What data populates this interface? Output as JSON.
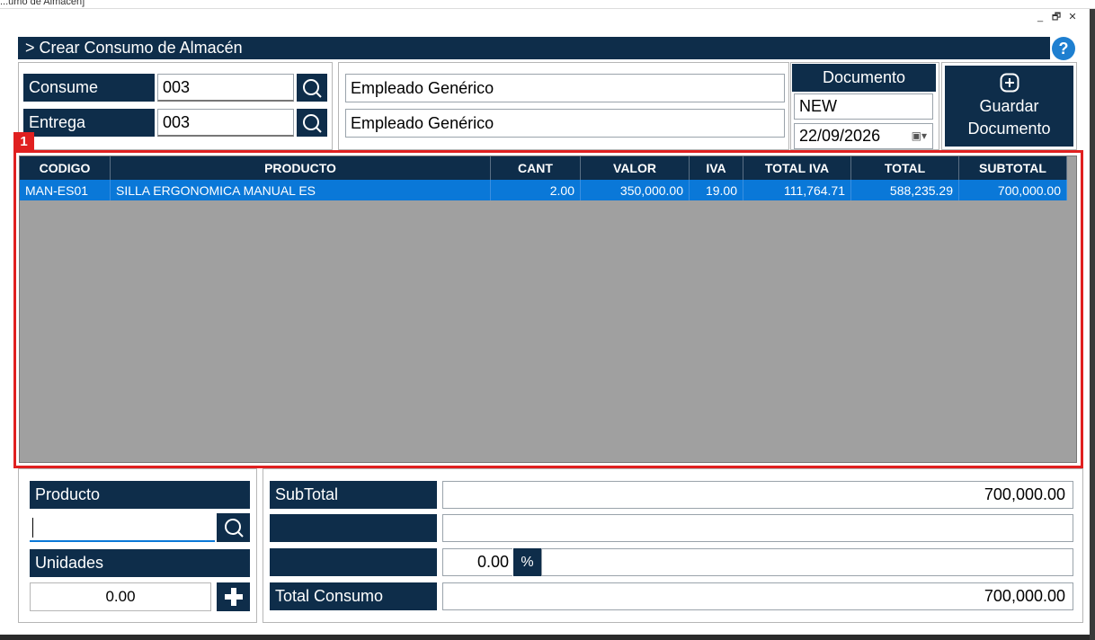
{
  "window": {
    "title": "...umo de Almacén]",
    "minimize": "_",
    "restore": "🗗",
    "close": "✕"
  },
  "header": {
    "title": "> Crear Consumo de Almacén",
    "help_icon": "?"
  },
  "form": {
    "consume_label": "Consume",
    "consume_value": "003",
    "entrega_label": "Entrega",
    "entrega_value": "003",
    "consume_name": "Empleado Genérico",
    "entrega_name": "Empleado Genérico",
    "documento_label": "Documento",
    "documento_value": "NEW",
    "fecha_value": "22/09/2026",
    "save_button_line1": "Guardar",
    "save_button_line2": "Documento"
  },
  "grid": {
    "marker": "1",
    "columns": [
      "CODIGO",
      "PRODUCTO",
      "CANT",
      "VALOR",
      "IVA",
      "TOTAL IVA",
      "TOTAL",
      "SUBTOTAL"
    ],
    "rows": [
      [
        "MAN-ES01",
        "SILLA ERGONOMICA MANUAL ES",
        "2.00",
        "350,000.00",
        "19.00",
        "111,764.71",
        "588,235.29",
        "700,000.00"
      ]
    ]
  },
  "bottom_left": {
    "producto_label": "Producto",
    "producto_value": "",
    "unidades_label": "Unidades",
    "unidades_value": "0.00"
  },
  "totals": {
    "subtotal_label": "SubTotal",
    "subtotal_value": "700,000.00",
    "row2_label": "",
    "row2_value": "",
    "descuento_value": "0.00",
    "percent_label": "%",
    "total_label": "Total Consumo",
    "total_value": "700,000.00"
  },
  "colors": {
    "navy": "#0e2d4a",
    "selection_blue": "#0a78d8",
    "grid_gray": "#a0a0a0",
    "highlight_red": "#e02020",
    "help_blue": "#1e7fd0"
  }
}
